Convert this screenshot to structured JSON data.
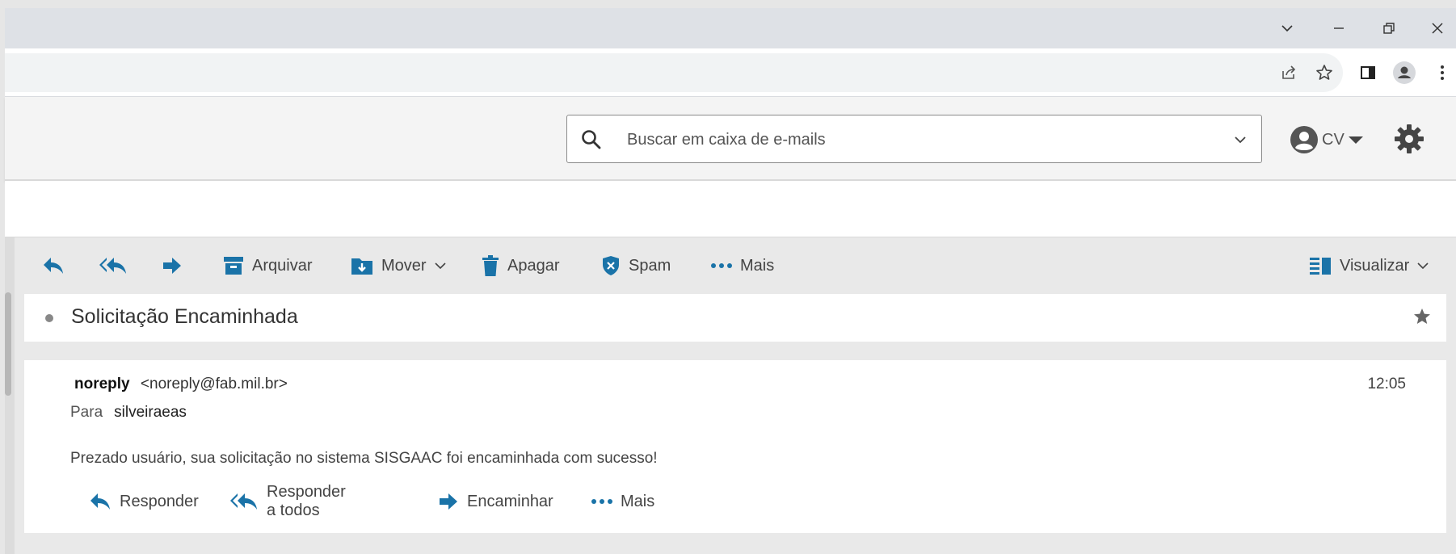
{
  "search": {
    "placeholder": "Buscar em caixa de e-mails"
  },
  "user": {
    "initials": "CV"
  },
  "toolbar": {
    "archive_label": "Arquivar",
    "move_label": "Mover",
    "delete_label": "Apagar",
    "spam_label": "Spam",
    "more_label": "Mais",
    "view_label": "Visualizar"
  },
  "message": {
    "subject": "Solicitação Encaminhada",
    "from_name": "noreply",
    "from_email": "<noreply@fab.mil.br>",
    "time": "12:05",
    "to_label": "Para",
    "to_value": "silveiraeas",
    "body": "Prezado usuário, sua solicitação no sistema SISGAAC foi encaminhada com sucesso!"
  },
  "message_actions": {
    "reply": "Responder",
    "reply_all": "Responder a todos",
    "forward": "Encaminhar",
    "more": "Mais"
  },
  "colors": {
    "accent": "#1a73a8",
    "icon_gray": "#555555"
  }
}
